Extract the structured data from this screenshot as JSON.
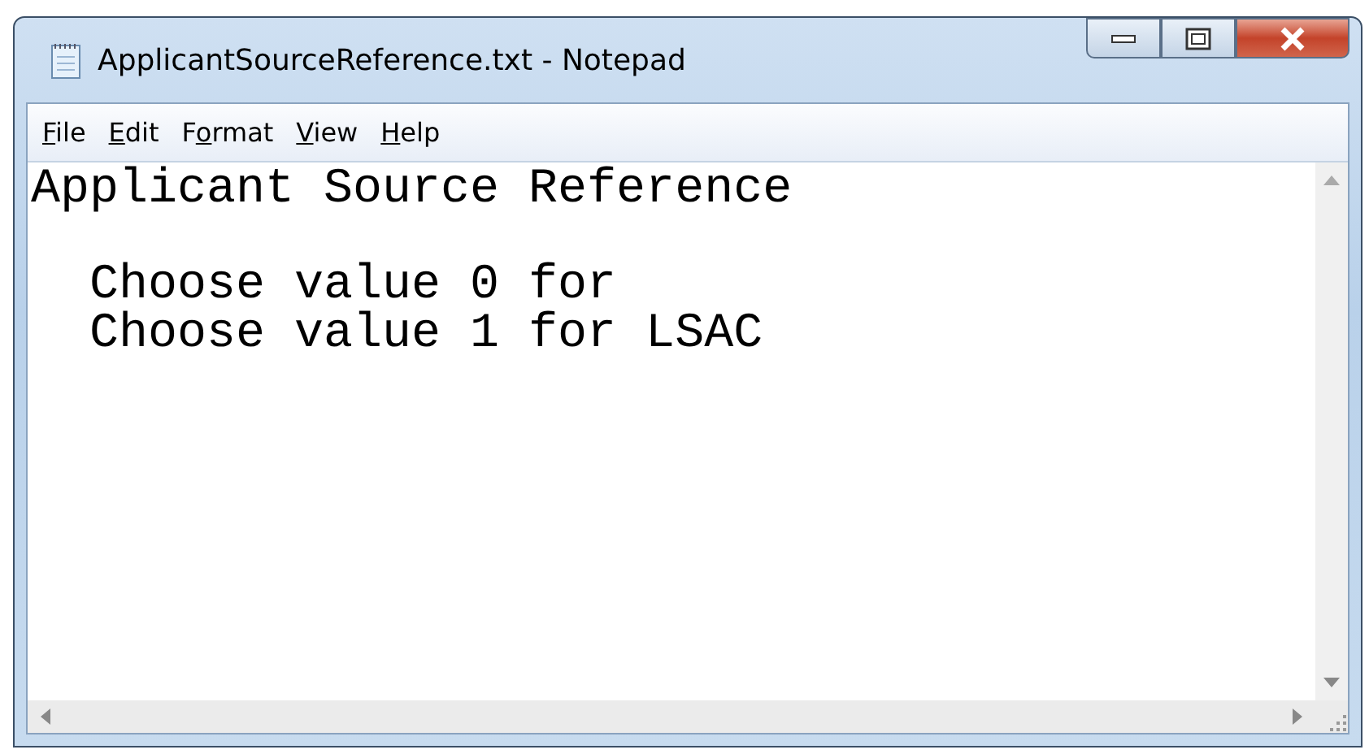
{
  "window": {
    "title": "ApplicantSourceReference.txt - Notepad"
  },
  "menu": [
    {
      "key": "F",
      "post": "ile"
    },
    {
      "key": "E",
      "post": "dit"
    },
    {
      "pre": "F",
      "key": "o",
      "post": "rmat"
    },
    {
      "key": "V",
      "post": "iew"
    },
    {
      "key": "H",
      "post": "elp"
    }
  ],
  "document": {
    "text": "Applicant Source Reference\n\n  Choose value 0 for\n  Choose value 1 for LSAC"
  }
}
